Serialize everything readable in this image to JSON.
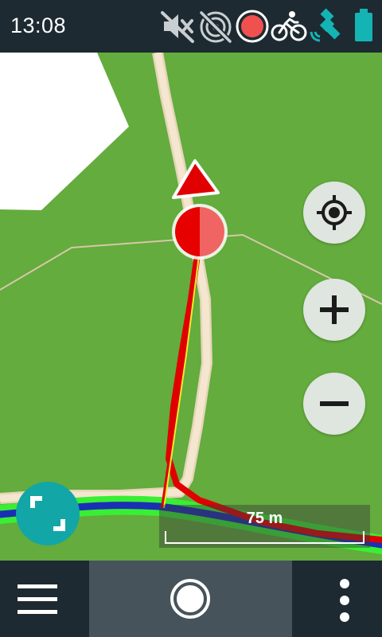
{
  "status_bar": {
    "time": "13:08",
    "icons": [
      "sound-muted-icon",
      "signal-off-icon",
      "recording-icon",
      "cycling-icon",
      "gps-icon",
      "battery-icon"
    ],
    "colors": {
      "background": "#1d2a31",
      "recording": "#f0504e",
      "accent": "#14b4b4"
    }
  },
  "map": {
    "scale_label": "75 m",
    "colors": {
      "land": "#63ac3d",
      "road": "#f2e2c8",
      "track": "#e00000",
      "river": "#1a2fb5"
    },
    "buttons": [
      "locate-button",
      "zoom-in-button",
      "zoom-out-button",
      "expand-button"
    ]
  },
  "bottom_bar": {
    "items": [
      "menu-button",
      "record-button",
      "more-options-button"
    ]
  }
}
